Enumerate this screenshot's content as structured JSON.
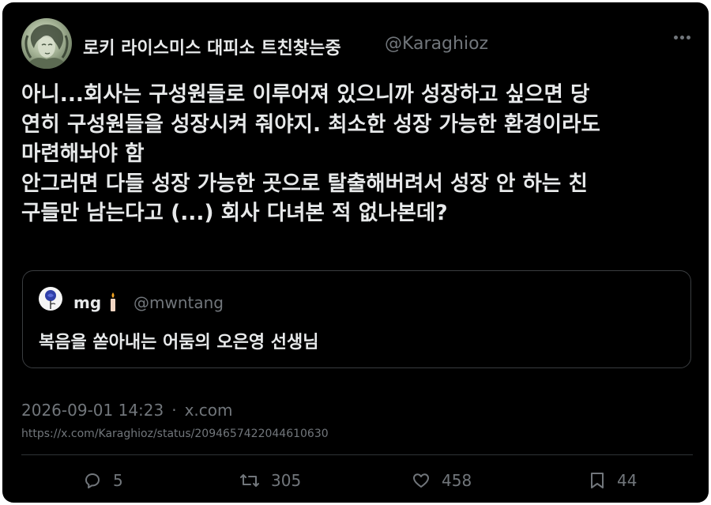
{
  "author": {
    "display_name": "로키 라이스미스 대피소 트친찾는중",
    "handle": "@Karaghioz"
  },
  "tweet": {
    "text": "아니...회사는 구성원들로 이루어져 있으니까 성장하고 싶으면 당\n연히 구성원들을 성장시켜 줘야지. 최소한 성장 가능한 환경이라도\n마련해놔야 함\n안그러면 다들 성장 가능한 곳으로 탈출해버려서 성장 안 하는 친\n구들만 남는다고 (...) 회사 다녀본 적 없나본데?"
  },
  "quoted": {
    "name": "mg",
    "handle": "@mwntang",
    "text": "복음을 쏟아내는 어둠의 오은영 선생님"
  },
  "meta": {
    "timestamp": "2026-09-01 14:23",
    "separator": "·",
    "source": "x.com",
    "url": "https://x.com/Karaghioz/status/2094657422044610630"
  },
  "stats": {
    "replies": "5",
    "retweets": "305",
    "likes": "458",
    "bookmarks": "44"
  },
  "icons": {
    "reply": "reply-icon",
    "retweet": "retweet-icon",
    "like": "heart-icon",
    "bookmark": "bookmark-icon",
    "more": "more-icon"
  },
  "colors": {
    "background": "#000000",
    "text": "#e7e9ea",
    "muted": "#71767b",
    "border": "#2f3336"
  }
}
